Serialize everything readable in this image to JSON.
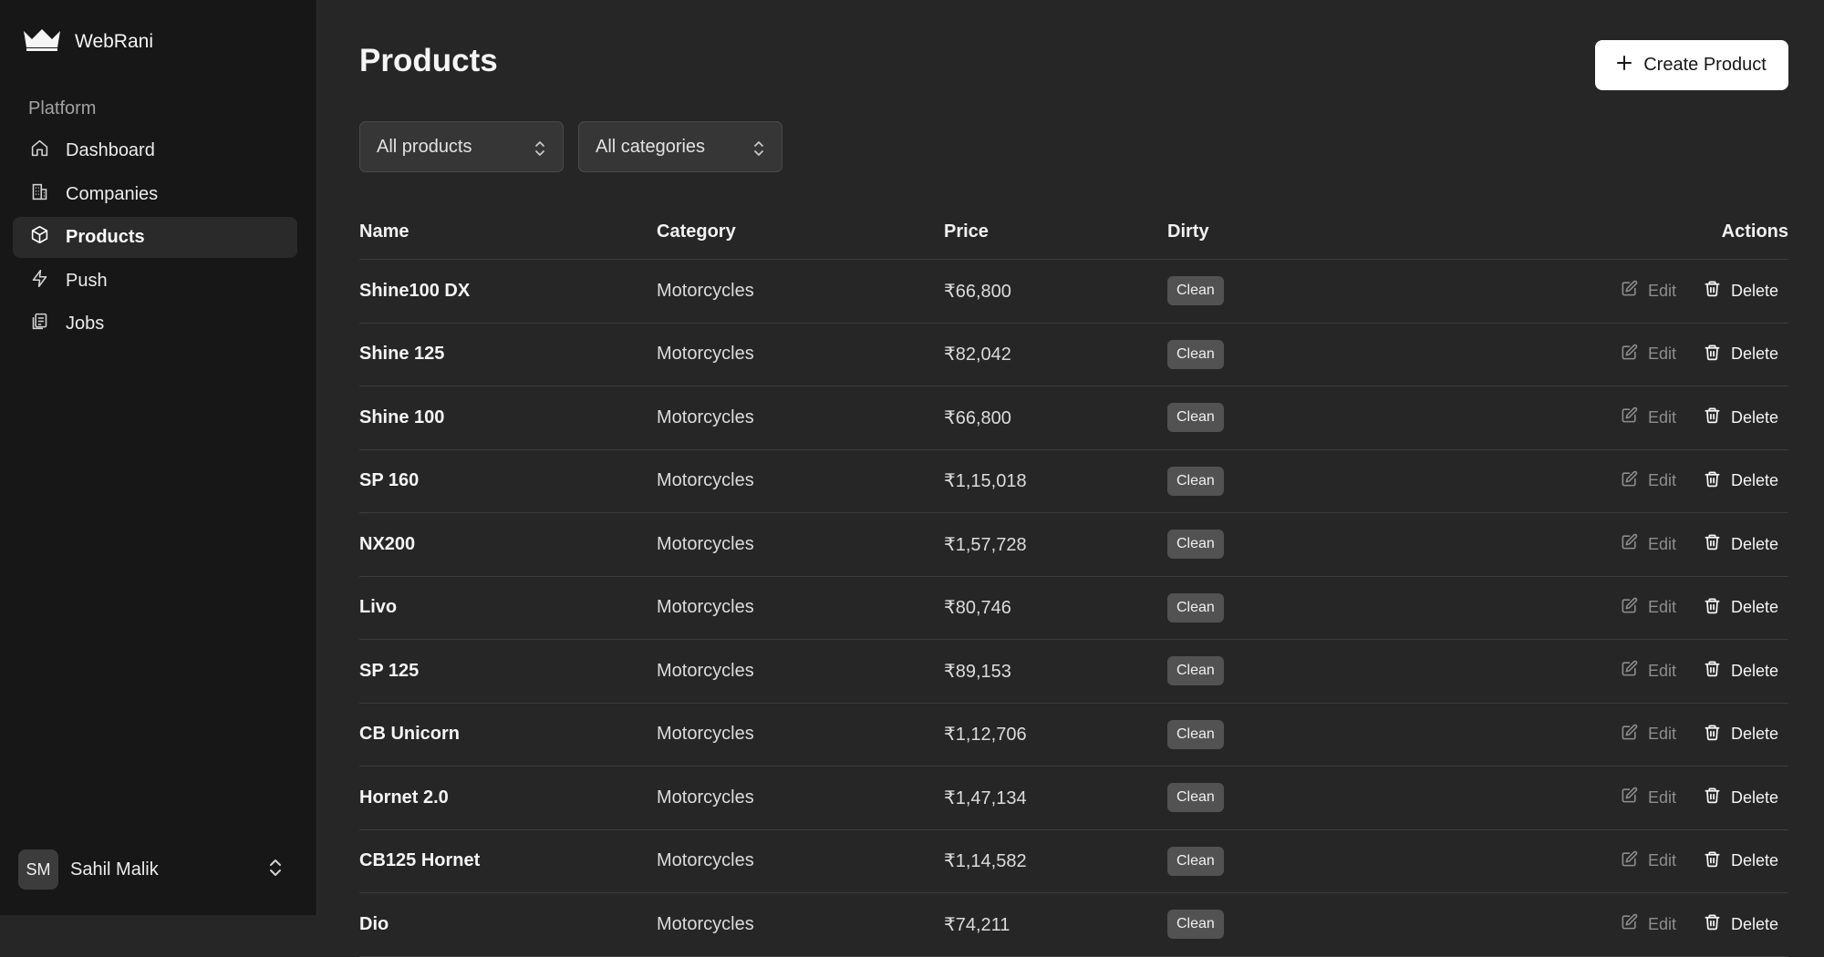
{
  "app": {
    "name": "WebRani"
  },
  "sidebar": {
    "section_label": "Platform",
    "items": [
      {
        "label": "Dashboard",
        "icon": "home-icon",
        "active": false
      },
      {
        "label": "Companies",
        "icon": "building-icon",
        "active": false
      },
      {
        "label": "Products",
        "icon": "box-icon",
        "active": true
      },
      {
        "label": "Push",
        "icon": "zap-icon",
        "active": false
      },
      {
        "label": "Jobs",
        "icon": "clipboard-icon",
        "active": false
      }
    ],
    "user": {
      "initials": "SM",
      "name": "Sahil Malik"
    }
  },
  "main": {
    "title": "Products",
    "create_button": "Create Product",
    "filters": {
      "products": "All products",
      "categories": "All categories"
    },
    "table": {
      "columns": {
        "name": "Name",
        "category": "Category",
        "price": "Price",
        "dirty": "Dirty",
        "actions": "Actions"
      },
      "edit_label": "Edit",
      "delete_label": "Delete",
      "rows": [
        {
          "name": "Shine100 DX",
          "category": "Motorcycles",
          "price": "₹66,800",
          "dirty": "Clean"
        },
        {
          "name": "Shine 125",
          "category": "Motorcycles",
          "price": "₹82,042",
          "dirty": "Clean"
        },
        {
          "name": "Shine 100",
          "category": "Motorcycles",
          "price": "₹66,800",
          "dirty": "Clean"
        },
        {
          "name": "SP 160",
          "category": "Motorcycles",
          "price": "₹1,15,018",
          "dirty": "Clean"
        },
        {
          "name": "NX200",
          "category": "Motorcycles",
          "price": "₹1,57,728",
          "dirty": "Clean"
        },
        {
          "name": "Livo",
          "category": "Motorcycles",
          "price": "₹80,746",
          "dirty": "Clean"
        },
        {
          "name": "SP 125",
          "category": "Motorcycles",
          "price": "₹89,153",
          "dirty": "Clean"
        },
        {
          "name": "CB Unicorn",
          "category": "Motorcycles",
          "price": "₹1,12,706",
          "dirty": "Clean"
        },
        {
          "name": "Hornet 2.0",
          "category": "Motorcycles",
          "price": "₹1,47,134",
          "dirty": "Clean"
        },
        {
          "name": "CB125 Hornet",
          "category": "Motorcycles",
          "price": "₹1,14,582",
          "dirty": "Clean"
        },
        {
          "name": "Dio",
          "category": "Motorcycles",
          "price": "₹74,211",
          "dirty": "Clean"
        }
      ]
    }
  }
}
